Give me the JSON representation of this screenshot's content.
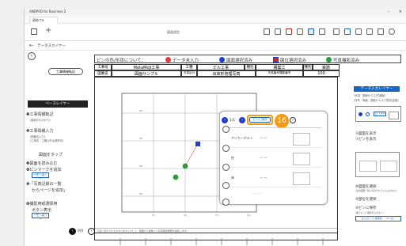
{
  "window": {
    "title": "ANDPAD for Business 2",
    "tab": "初めてe",
    "doc_title": "図面設定"
  },
  "nav": {
    "back_label": "データスカイヤー",
    "crumb": "ー"
  },
  "legend": {
    "heading": "ピンの色/形状について：",
    "items": [
      {
        "label": "データ未入力",
        "color": "#e53935"
      },
      {
        "label": "図面選択済み",
        "color": "#1e40c8"
      },
      {
        "label": "図位選択済み",
        "color": "#c62828"
      },
      {
        "label": "写真撮影済み",
        "color": "#2e9c3a"
      }
    ]
  },
  "info_table": {
    "row1": [
      "工事号",
      "MetaMoJi工事",
      "工種",
      "ビル工事",
      "種別",
      "構築工",
      "種別",
      "鉄筋"
    ],
    "row2": [
      "図番名",
      "図面サンプル",
      "写真区分",
      "出来形管理写真",
      "写真番号撮影番号",
      "100"
    ]
  },
  "left_panel": {
    "step1_button": "工事情報転記",
    "base_layer": "ベースレイヤー",
    "s1_title": "❶工事情報転記",
    "s1_sub": "(撮影のものから)",
    "s2_title": "❷工事情報入力",
    "s2_sub1": "(図面名入力)",
    "s2_sub2": "(工事名・工種以外は選択可)",
    "tap_title": "図面をタップ",
    "t1": "❸図面を読み込む",
    "t2": "❹ピンマークを追加",
    "t2_btn": "ー任へ戻くー",
    "t3a": "❺「写真記録の一覧",
    "t3b": "からページを追加」",
    "s4a": "❻撮影用紙選择用",
    "s4b": "ボタン表示",
    "s4_btn": "ー任へ戻くー",
    "page_indicator": "0/0"
  },
  "popup": {
    "pager": "1/1",
    "save_btn": "ピンに保存",
    "badge": "16",
    "rows": [
      {
        "label": "アンカーボルト",
        "value": "ー ー"
      },
      {
        "label": "柱",
        "value": "ー ー"
      },
      {
        "label": "床",
        "value": "ー ー"
      }
    ],
    "footer": "...........  ..."
  },
  "right_panel": {
    "heading": "データ入力レイヤー",
    "sub1": "(写真：図面サエス/付通撮)",
    "sub2": "(所有・場面：図面サエスで書別(記載)",
    "note1": "⑤図面を表示",
    "note2": "⑦ピンを表示",
    "note3": "⑧図面を選択",
    "note3_sub": "(近の図面一覧に表示されているものから)",
    "note4": "⑨部位を選択",
    "note5": "⑩ピンに保存",
    "note5_sub": "(図でピンに保存するボタン)",
    "save_all": "全てのピンに保存除・・④へ戻く",
    "tiny_label": "ピンに保存"
  },
  "bottom_note": "下記に表示できるボタンをタップして、図面から画像した写真確認機能を画集します。",
  "grid_labels": [
    "X1",
    "X2",
    "X3",
    "X4",
    "Y1",
    "Y2",
    "Y3",
    "Y4"
  ]
}
